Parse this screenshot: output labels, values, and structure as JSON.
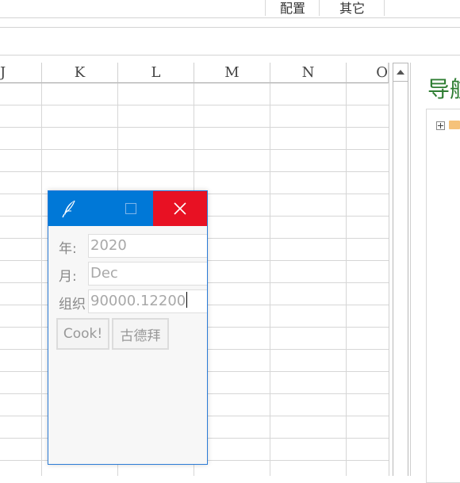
{
  "ribbon": {
    "tabs": [
      "配置",
      "其它"
    ]
  },
  "sheet": {
    "columns": [
      "J",
      "K",
      "L",
      "M",
      "N",
      "O"
    ]
  },
  "navigation_pane": {
    "title": "导航"
  },
  "dialog": {
    "title_icon": "feather-icon",
    "close_icon": "close-icon",
    "fields": {
      "year": {
        "label": "年:",
        "value": "2020"
      },
      "month": {
        "label": "月:",
        "value": "Dec"
      },
      "org": {
        "label": "组织",
        "value": "90000.12200"
      }
    },
    "buttons": {
      "cook": "Cook!",
      "gudebai": "古德拜"
    }
  },
  "colors": {
    "titlebar": "#0078d7",
    "close": "#e81123",
    "nav_title": "#2e7d32"
  }
}
